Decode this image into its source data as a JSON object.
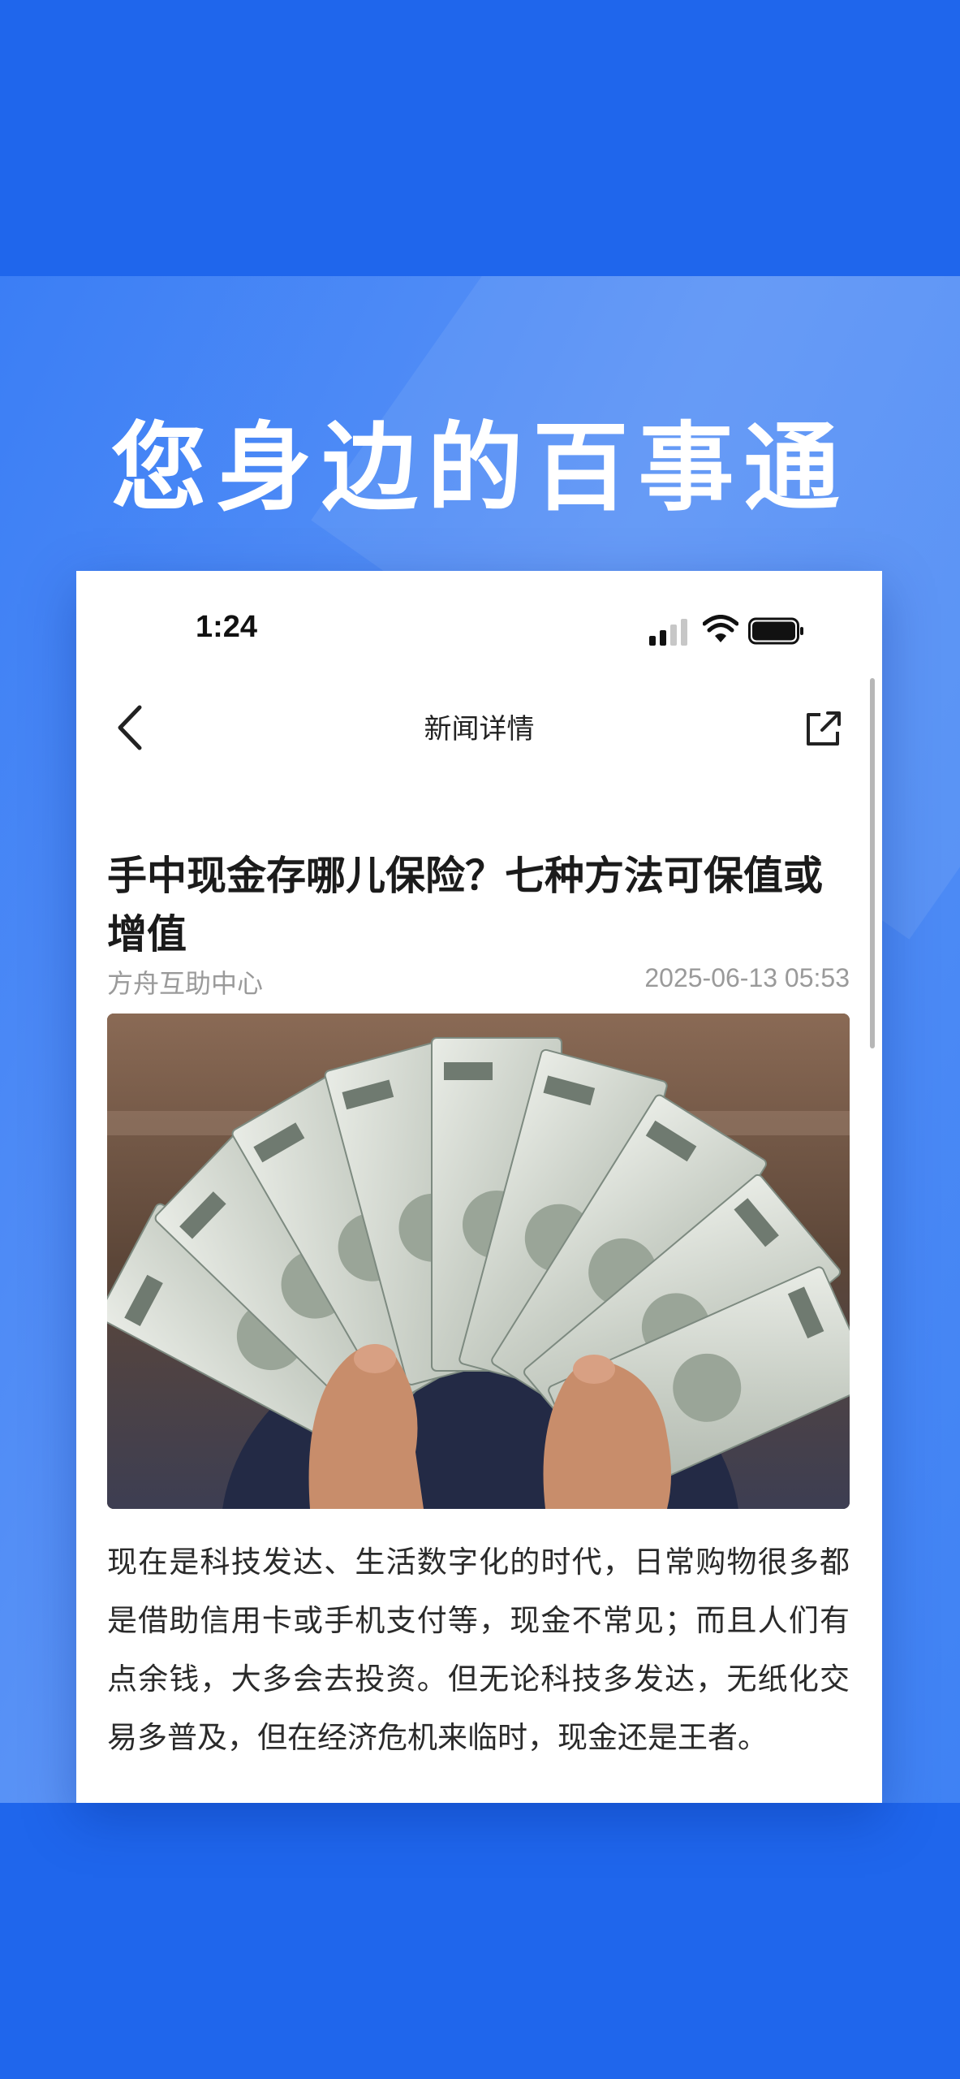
{
  "promo": {
    "slogan": "您身边的百事通",
    "colors": {
      "top_band": "#1f66ec",
      "middle_band": "#4d8af5",
      "bottom_band": "#1f66ec"
    }
  },
  "status_bar": {
    "time": "1:24",
    "icons": [
      "signal-icon",
      "wifi-icon",
      "battery-icon"
    ]
  },
  "nav": {
    "back_icon": "chevron-left-icon",
    "title": "新闻详情",
    "share_icon": "share-icon"
  },
  "article": {
    "title": "手中现金存哪儿保险？七种方法可保值或增值",
    "source": "方舟互助中心",
    "date": "2025-06-13 05:53",
    "image_description": "hands-fanning-100-dollar-bills",
    "body": "现在是科技发达、生活数字化的时代，日常购物很多都是借助信用卡或手机支付等，现金不常见；而且人们有点余钱，大多会去投资。但无论科技多发达，无纸化交易多普及，但在经济危机来临时，现金还是王者。"
  }
}
